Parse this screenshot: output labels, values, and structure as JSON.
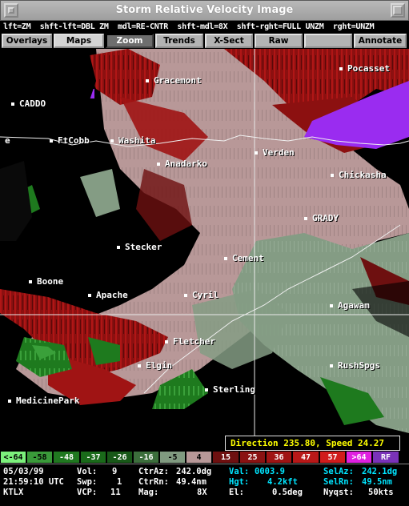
{
  "window": {
    "title": "Storm Relative Velocity Image"
  },
  "hints": "lft=ZM  shft-lft=DBL ZM  mdl=RE-CNTR  shft-mdl=8X  shft-rght=FULL UNZM  rght=UNZM",
  "toolbar": {
    "buttons": [
      "Overlays",
      "Maps",
      "Zoom",
      "Trends",
      "X-Sect",
      "Raw Data",
      "",
      "Annotate"
    ]
  },
  "map": {
    "cities": [
      {
        "name": "Gracemont"
      },
      {
        "name": "Pocasset"
      },
      {
        "name": "CADDO"
      },
      {
        "name": "FtCobb"
      },
      {
        "name": "Washita"
      },
      {
        "name": "Verden"
      },
      {
        "name": "Anadarko"
      },
      {
        "name": "Chickasha"
      },
      {
        "name": "GRADY"
      },
      {
        "name": "Stecker"
      },
      {
        "name": "Cement"
      },
      {
        "name": "Boone"
      },
      {
        "name": "Apache"
      },
      {
        "name": "Cyril"
      },
      {
        "name": "Agawam"
      },
      {
        "name": "Fletcher"
      },
      {
        "name": "Elgin"
      },
      {
        "name": "RushSpgs"
      },
      {
        "name": "Sterling"
      },
      {
        "name": "MedicinePark"
      },
      {
        "name": "e"
      }
    ],
    "direction_label": "Direction 235.80, Speed 24.27"
  },
  "legend": [
    {
      "label": "<-64",
      "bg": "#7cf07c",
      "fg": "#000000"
    },
    {
      "label": "-58",
      "bg": "#3a9a3a",
      "fg": "#000000"
    },
    {
      "label": "-48",
      "bg": "#207820",
      "fg": "#ffffff"
    },
    {
      "label": "-37",
      "bg": "#1a6a1a",
      "fg": "#ffffff"
    },
    {
      "label": "-26",
      "bg": "#185818",
      "fg": "#ffffff"
    },
    {
      "label": "-16",
      "bg": "#3c6e3c",
      "fg": "#ffffff"
    },
    {
      "label": "-5",
      "bg": "#809a80",
      "fg": "#000000"
    },
    {
      "label": "4",
      "bg": "#b89898",
      "fg": "#000000"
    },
    {
      "label": "15",
      "bg": "#6e1010",
      "fg": "#ffffff"
    },
    {
      "label": "25",
      "bg": "#8a1212",
      "fg": "#ffffff"
    },
    {
      "label": "36",
      "bg": "#a01414",
      "fg": "#ffffff"
    },
    {
      "label": "47",
      "bg": "#b81818",
      "fg": "#ffffff"
    },
    {
      "label": "57",
      "bg": "#d01c1c",
      "fg": "#ffffff"
    },
    {
      "label": ">64",
      "bg": "#e020e0",
      "fg": "#ffffff"
    },
    {
      "label": "RF",
      "bg": "#7a32b8",
      "fg": "#ffffff"
    }
  ],
  "status": {
    "date": "05/03/99",
    "time": "21:59:10 UTC",
    "radar": "KTLX",
    "vol_label": "Vol:",
    "vol": "9",
    "swp_label": "Swp:",
    "swp": "1",
    "vcp_label": "VCP:",
    "vcp": "11",
    "ctraz_label": "CtrAz:",
    "ctraz": "242.0dg",
    "ctrrn_label": "CtrRn:",
    "ctrrn": "49.4nm",
    "mag_label": "Mag:",
    "mag": "8X",
    "val_label": "Val:",
    "val": "0003.9",
    "hgt_label": "Hgt:",
    "hgt": "4.2kft",
    "el_label": "El:",
    "el": "0.5deg",
    "selaz_label": "SelAz:",
    "selaz": "242.1dg",
    "selrn_label": "SelRn:",
    "selrn": "49.5nm",
    "nyqst_label": "Nyqst:",
    "nyqst": "50kts"
  },
  "colors": {
    "pink": "#b89898",
    "darkred": "#8c1010",
    "red": "#c01818",
    "gray_green": "#849c84",
    "green": "#1e7a1e",
    "magenta": "#9a2cf0"
  }
}
